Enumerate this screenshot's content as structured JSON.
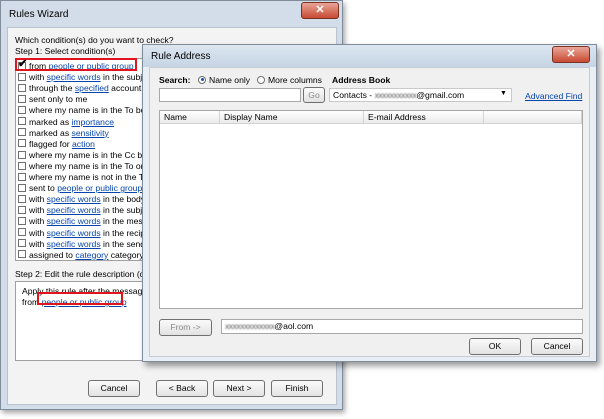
{
  "rules_wizard": {
    "title": "Rules Wizard",
    "close_glyph": "✕",
    "question": "Which condition(s) do you want to check?",
    "step1_label": "Step 1: Select condition(s)",
    "conditions": [
      {
        "pre": "from ",
        "link": "people or public group",
        "post": "",
        "checked": true
      },
      {
        "pre": "with ",
        "link": "specific words",
        "post": " in the subject",
        "checked": false
      },
      {
        "pre": "through the ",
        "link": "specified",
        "post": " account",
        "checked": false
      },
      {
        "pre": "sent only to me",
        "link": "",
        "post": "",
        "checked": false
      },
      {
        "pre": "where my name is in the To box",
        "link": "",
        "post": "",
        "checked": false
      },
      {
        "pre": "marked as ",
        "link": "importance",
        "post": "",
        "checked": false
      },
      {
        "pre": "marked as ",
        "link": "sensitivity",
        "post": "",
        "checked": false
      },
      {
        "pre": "flagged for ",
        "link": "action",
        "post": "",
        "checked": false
      },
      {
        "pre": "where my name is in the Cc box",
        "link": "",
        "post": "",
        "checked": false
      },
      {
        "pre": "where my name is in the To or Cc box",
        "link": "",
        "post": "",
        "checked": false
      },
      {
        "pre": "where my name is not in the To box",
        "link": "",
        "post": "",
        "checked": false
      },
      {
        "pre": "sent to ",
        "link": "people or public group",
        "post": "",
        "checked": false
      },
      {
        "pre": "with ",
        "link": "specific words",
        "post": " in the body",
        "checked": false
      },
      {
        "pre": "with ",
        "link": "specific words",
        "post": " in the subject or body",
        "checked": false
      },
      {
        "pre": "with ",
        "link": "specific words",
        "post": " in the message header",
        "checked": false
      },
      {
        "pre": "with ",
        "link": "specific words",
        "post": " in the recipient's address",
        "checked": false
      },
      {
        "pre": "with ",
        "link": "specific words",
        "post": " in the sender's address",
        "checked": false
      },
      {
        "pre": "assigned to ",
        "link": "category",
        "post": " category",
        "checked": false
      }
    ],
    "step2_label": "Step 2: Edit the rule description (click an underlined value)",
    "desc_line1": "Apply this rule after the message arrives",
    "desc_from": "from ",
    "desc_link": "people or public group",
    "buttons": {
      "cancel": "Cancel",
      "back": "< Back",
      "next": "Next >",
      "finish": "Finish"
    }
  },
  "rule_address": {
    "title": "Rule Address",
    "close_glyph": "✕",
    "search_label": "Search:",
    "radio_name_only": "Name only",
    "radio_more_columns": "More columns",
    "address_book_label": "Address Book",
    "search_value": "",
    "go_button": "Go",
    "address_book_value": "Contacts - ",
    "address_book_blurred": "xxxxxxxxxxx",
    "address_book_domain": "@gmail.com",
    "dropdown_glyph": "▼",
    "advanced_find": "Advanced Find",
    "columns": [
      "Name",
      "Display Name",
      "E-mail Address"
    ],
    "from_button": "From ->",
    "from_blurred": "xxxxxxxxxxxxx",
    "from_domain": "@aol.com",
    "ok_button": "OK",
    "cancel_button": "Cancel"
  },
  "colors": {
    "highlight_box": "#e0151c",
    "link": "#0645ad"
  }
}
